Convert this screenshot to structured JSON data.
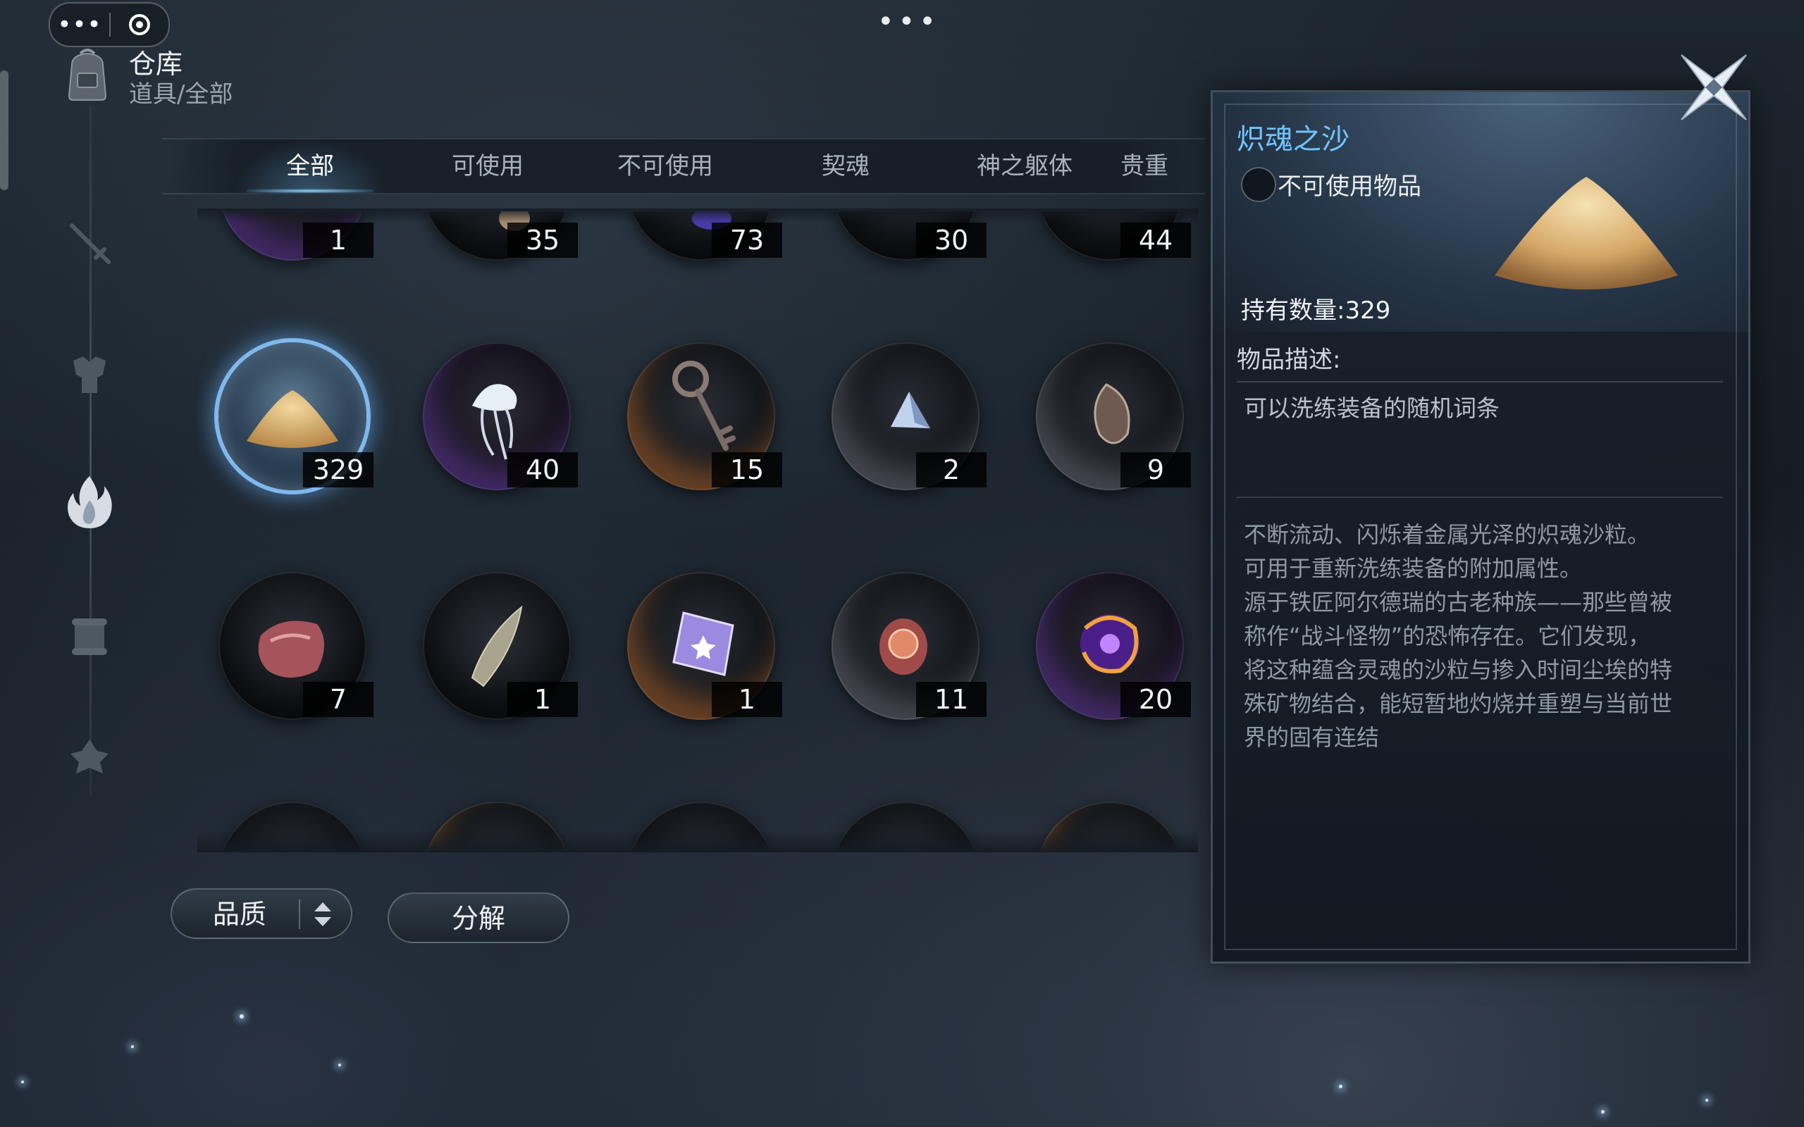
{
  "capsule": {
    "more": "•••"
  },
  "top_menu": "•••",
  "header": {
    "title": "仓库",
    "breadcrumb": "道具/全部",
    "icon": "backpack-icon"
  },
  "sidebar": {
    "items": [
      {
        "icon": "sword-icon",
        "active": false
      },
      {
        "icon": "armor-icon",
        "active": false
      },
      {
        "icon": "flame-icon",
        "active": true
      },
      {
        "icon": "scroll-icon",
        "active": false
      },
      {
        "icon": "emblem-icon",
        "active": false
      }
    ]
  },
  "tabs": [
    {
      "label": "全部",
      "active": true
    },
    {
      "label": "可使用",
      "active": false
    },
    {
      "label": "不可使用",
      "active": false
    },
    {
      "label": "契魂",
      "active": false
    },
    {
      "label": "神之躯体",
      "active": false
    },
    {
      "label": "贵重",
      "active": false
    }
  ],
  "items": {
    "row0": [
      {
        "count": "1",
        "icon": "unknown-item-icon"
      },
      {
        "count": "35",
        "icon": "log-icon"
      },
      {
        "count": "73",
        "icon": "berry-icon"
      },
      {
        "count": "30",
        "icon": "shard-icon"
      },
      {
        "count": "44",
        "icon": "ore-icon"
      }
    ],
    "row1": [
      {
        "count": "329",
        "icon": "soul-sand-icon",
        "selected": true
      },
      {
        "count": "40",
        "icon": "jellyfish-icon"
      },
      {
        "count": "15",
        "icon": "key-icon"
      },
      {
        "count": "2",
        "icon": "crystal-pyramid-icon"
      },
      {
        "count": "9",
        "icon": "seed-icon"
      }
    ],
    "row2": [
      {
        "count": "7",
        "icon": "meat-icon"
      },
      {
        "count": "1",
        "icon": "bone-blade-icon"
      },
      {
        "count": "1",
        "icon": "star-gem-icon"
      },
      {
        "count": "11",
        "icon": "flower-drum-icon"
      },
      {
        "count": "20",
        "icon": "void-core-icon"
      }
    ]
  },
  "buttons": {
    "quality": "品质",
    "decompose": "分解"
  },
  "detail": {
    "name": "炽魂之沙",
    "type": "不可使用物品",
    "owned": "持有数量:329",
    "desc_label": "物品描述:",
    "desc_short": "可以洗练装备的随机词条",
    "lore": "不断流动、闪烁着金属光泽的炽魂沙粒。\n可用于重新洗练装备的附加属性。\n源于铁匠阿尔德瑞的古老种族——那些曾被\n称作“战斗怪物”的恐怖存在。它们发现，\n将这种蕴含灵魂的沙粒与掺入时间尘埃的特\n殊矿物结合，能短暂地灼烧并重塑与当前世\n界的固有连结"
  },
  "colors": {
    "accent": "#6fc3ff",
    "selected_glow": "#8cc8ff"
  }
}
